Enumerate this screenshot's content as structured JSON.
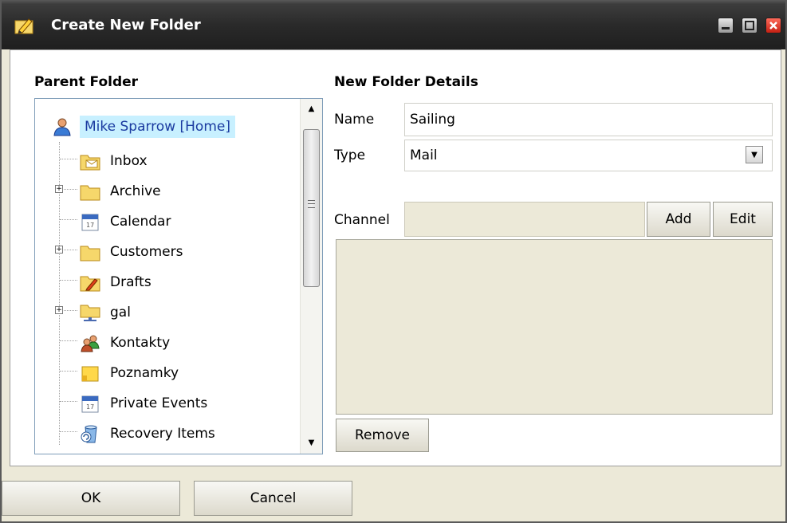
{
  "window": {
    "title": "Create New Folder",
    "title_icon": "pencil-folder-icon"
  },
  "parent_folder": {
    "heading": "Parent Folder",
    "root": {
      "label": "Mike Sparrow [Home]",
      "icon": "user-icon",
      "selected": true
    },
    "items": [
      {
        "label": "Inbox",
        "icon": "inbox-icon",
        "expandable": false
      },
      {
        "label": "Archive",
        "icon": "folder-icon",
        "expandable": true
      },
      {
        "label": "Calendar",
        "icon": "calendar-icon",
        "expandable": false
      },
      {
        "label": "Customers",
        "icon": "folder-icon",
        "expandable": true
      },
      {
        "label": "Drafts",
        "icon": "drafts-icon",
        "expandable": false
      },
      {
        "label": "gal",
        "icon": "shared-folder-icon",
        "expandable": true
      },
      {
        "label": "Kontakty",
        "icon": "contacts-icon",
        "expandable": false
      },
      {
        "label": "Poznamky",
        "icon": "notes-icon",
        "expandable": false
      },
      {
        "label": "Private Events",
        "icon": "calendar-icon",
        "expandable": false
      },
      {
        "label": "Recovery Items",
        "icon": "recovery-icon",
        "expandable": false
      }
    ]
  },
  "details": {
    "heading": "New Folder Details",
    "name_label": "Name",
    "name_value": "Sailing",
    "type_label": "Type",
    "type_value": "Mail",
    "channel_label": "Channel",
    "channel_value": "",
    "add_label": "Add",
    "edit_label": "Edit",
    "remove_label": "Remove"
  },
  "footer": {
    "ok_label": "OK",
    "cancel_label": "Cancel"
  },
  "colors": {
    "selection": "#c8f0ff",
    "titlebar": "#2a2a2a",
    "background": "#ece9d8"
  }
}
